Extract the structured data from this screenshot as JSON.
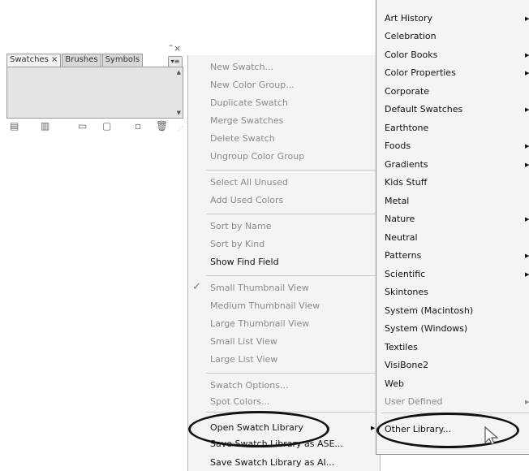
{
  "panel": {
    "tabs": [
      "Swatches ×",
      "Brushes",
      "Symbols"
    ],
    "close_glyph": "×",
    "minimize_glyph": "–",
    "menu_glyph": "▾≡",
    "footer_icons": [
      "swatch-libraries-menu-icon",
      "show-swatch-kinds-icon",
      "swatch-options-icon",
      "new-color-group-icon",
      "new-swatch-icon",
      "delete-swatch-icon"
    ]
  },
  "menu": {
    "items": [
      "New Swatch...",
      "New Color Group...",
      "Duplicate Swatch",
      "Merge Swatches",
      "Delete Swatch",
      "Ungroup Color Group",
      "Select All Unused",
      "Add Used Colors",
      "Sort by Name",
      "Sort by Kind",
      "Show Find Field",
      "Small Thumbnail View",
      "Medium Thumbnail View",
      "Large Thumbnail View",
      "Small List View",
      "Large List View",
      "Swatch Options...",
      "Spot Colors...",
      "Open Swatch Library",
      "Save Swatch Library as ASE...",
      "Save Swatch Library as AI..."
    ],
    "check_glyph": "✓",
    "arrow_glyph": "▶"
  },
  "library": {
    "items": [
      "Art History",
      "Celebration",
      "Color Books",
      "Color Properties",
      "Corporate",
      "Default Swatches",
      "Earthtone",
      "Foods",
      "Gradients",
      "Kids Stuff",
      "Metal",
      "Nature",
      "Neutral",
      "Patterns",
      "Scientific",
      "Skintones",
      "System (Macintosh)",
      "System (Windows)",
      "Textiles",
      "VisiBone2",
      "Web",
      "User Defined",
      "Other Library..."
    ]
  }
}
